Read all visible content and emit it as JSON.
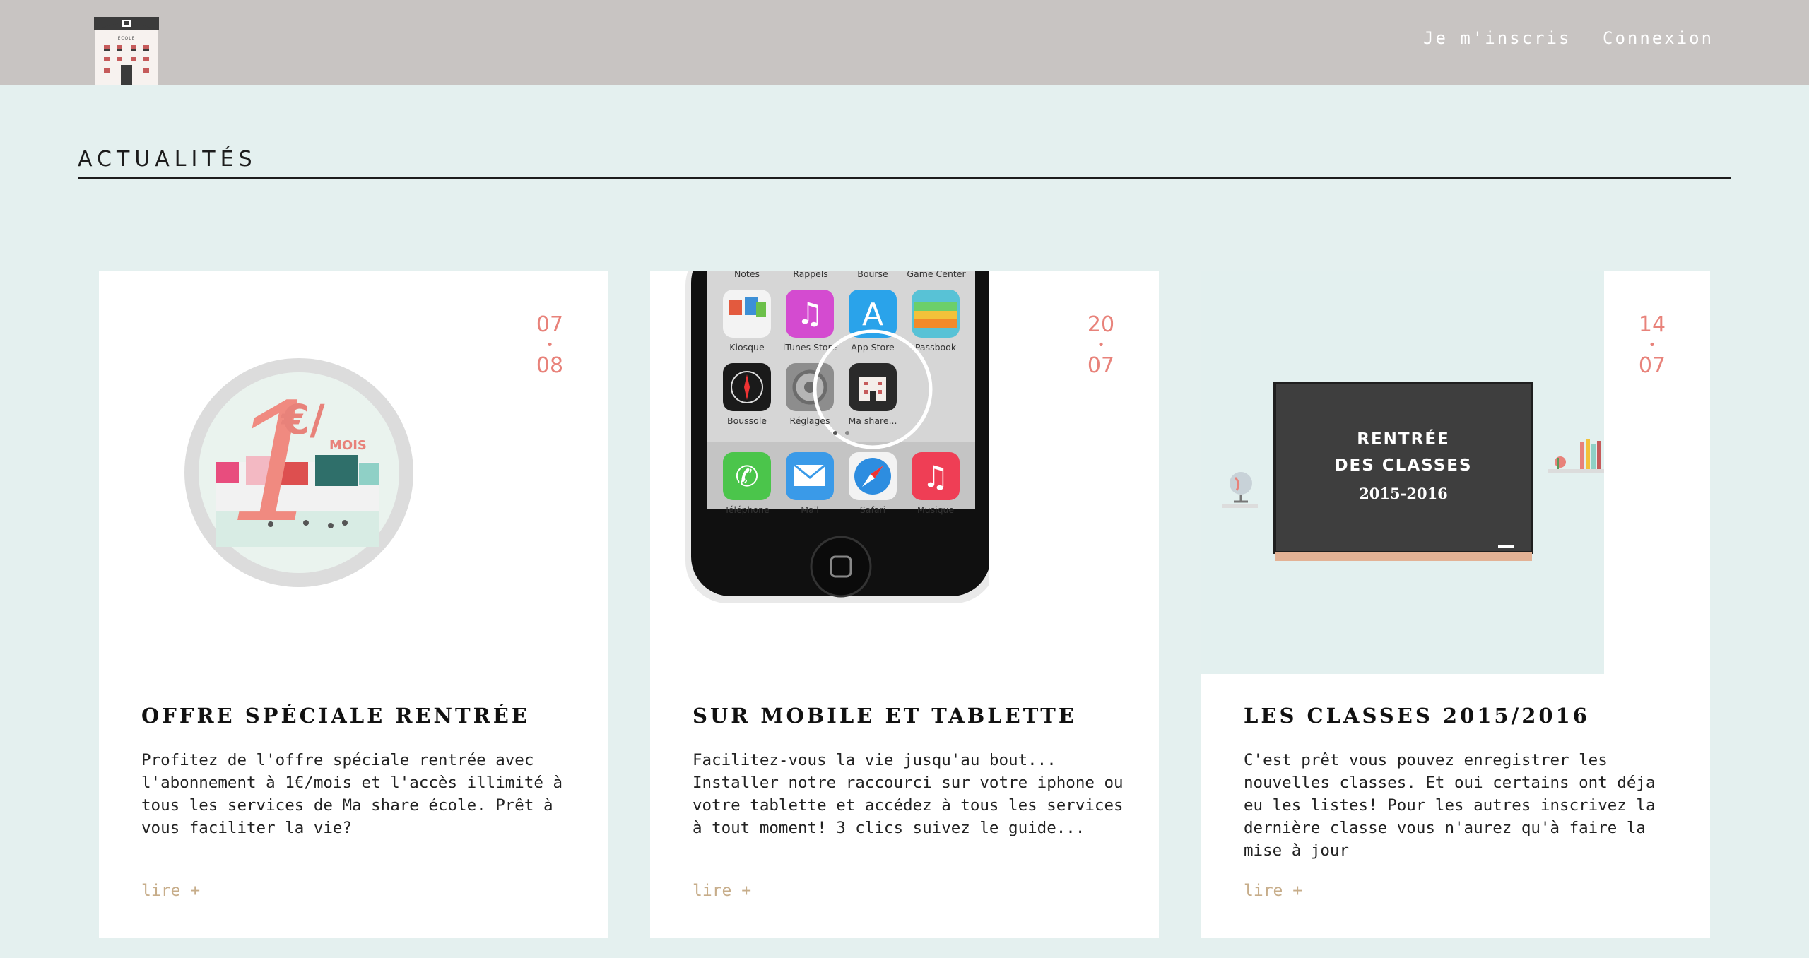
{
  "header": {
    "logo_text": "ÉCOLE",
    "nav": [
      {
        "label": "Je m'inscris"
      },
      {
        "label": "Connexion"
      }
    ]
  },
  "section": {
    "title": "ACTUALITÉS"
  },
  "cards": [
    {
      "date_day": "07",
      "date_month": "08",
      "title": "OFFRE SPÉCIALE RENTRÉE",
      "text": "Profitez de l'offre spéciale rentrée avec l'abonnement à 1€/mois et l'accès illimité à tous les services de Ma share école. Prêt à vous faciliter la vie?",
      "more": "lire +",
      "image": {
        "price": "1",
        "currency": "€/",
        "unit": "MOIS"
      }
    },
    {
      "date_day": "20",
      "date_month": "07",
      "title": "SUR MOBILE ET TABLETTE",
      "text": "Facilitez-vous la vie jusqu'au bout... Installer notre raccourci sur votre iphone ou votre tablette et accédez à tous les services à tout moment! 3 clics suivez le guide...",
      "more": "lire +",
      "image": {
        "top_labels": [
          "Notes",
          "Rappels",
          "Bourse",
          "Game Center"
        ],
        "row1_labels": [
          "Kiosque",
          "iTunes Store",
          "App Store",
          "Passbook"
        ],
        "row2_labels": [
          "Boussole",
          "Réglages",
          "Ma share..."
        ],
        "dock_labels": [
          "Téléphone",
          "Mail",
          "Safari",
          "Musique"
        ]
      }
    },
    {
      "date_day": "14",
      "date_month": "07",
      "title": "LES CLASSES 2015/2016",
      "text": "C'est prêt vous pouvez enregistrer les nouvelles classes. Et oui certains ont déja eu les listes! Pour les autres inscrivez la dernière classe vous n'aurez qu'à faire la mise à jour",
      "more": "lire +",
      "image": {
        "line1": "RENTRÉE",
        "line2": "DES CLASSES",
        "line3": "2015-2016"
      }
    }
  ],
  "colors": {
    "topbar": "#c8c4c2",
    "background": "#e4f0ef",
    "date": "#e8827a",
    "link": "#c7ad8a"
  }
}
